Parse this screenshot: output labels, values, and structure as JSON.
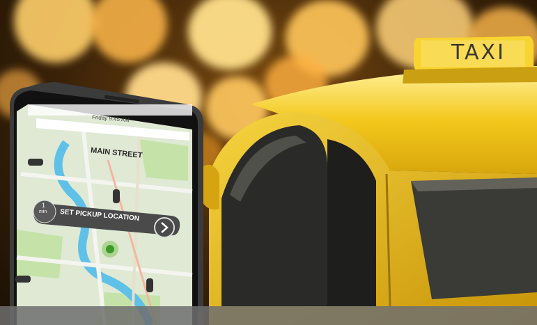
{
  "photo": {
    "taxi_sign": "TAXI",
    "phone": {
      "status_time": "Friday 9:45 AM",
      "location_label": "MAIN STREET",
      "eta_value": "1",
      "eta_unit": "min",
      "pickup_button_label": "SET PICKUP LOCATION"
    }
  },
  "colors": {
    "taxi_yellow": "#f2c51a",
    "bokeh_orange": "#ffb340",
    "phone_map_green": "#cfe8b8",
    "river_blue": "#5fc0e8"
  }
}
